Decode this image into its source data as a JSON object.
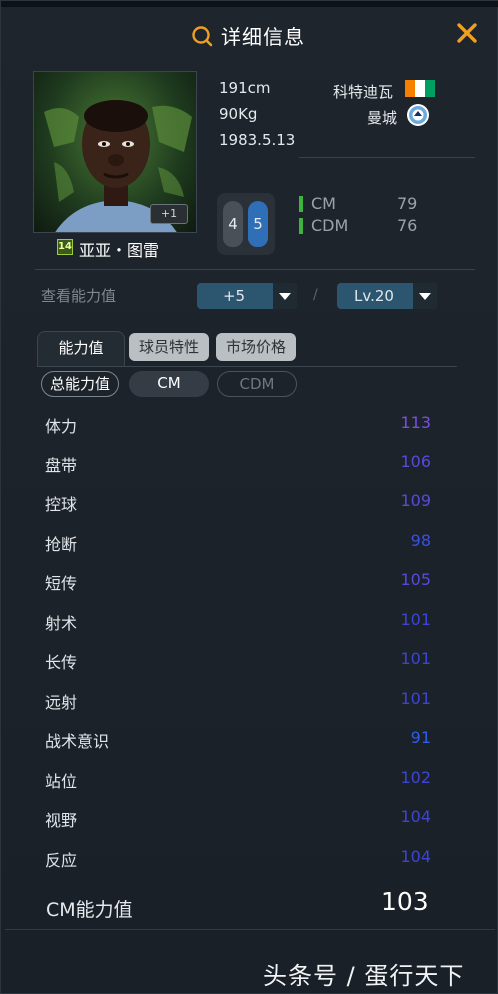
{
  "header": {
    "title": "详细信息",
    "search_icon": "search-icon",
    "close_icon": "close-icon"
  },
  "player": {
    "name": "亚亚・图雷",
    "season_badge": "14",
    "plus_badge": "+1",
    "height": "191cm",
    "weight": "90Kg",
    "birthdate": "1983.5.13",
    "nation": "科特迪瓦",
    "club": "曼城",
    "flag_colors": [
      "#f77f00",
      "#ffffff",
      "#009e60"
    ],
    "left_foot": "4",
    "right_foot": "5",
    "positions": [
      {
        "pos": "CM",
        "rating": "79"
      },
      {
        "pos": "CDM",
        "rating": "76"
      }
    ]
  },
  "controls": {
    "view_label": "查看能力值",
    "boost_select": "+5",
    "level_select": "Lv.20",
    "separator": "/"
  },
  "tabs": [
    {
      "label": "能力值",
      "active": true
    },
    {
      "label": "球员特性",
      "active": false
    },
    {
      "label": "市场价格",
      "active": false
    }
  ],
  "filters": [
    {
      "label": "总能力值"
    },
    {
      "label": "CM"
    },
    {
      "label": "CDM"
    }
  ],
  "stats": [
    {
      "name": "体力",
      "value": "113",
      "color": "#7a4fe0"
    },
    {
      "name": "盘带",
      "value": "106",
      "color": "#5a49db"
    },
    {
      "name": "控球",
      "value": "109",
      "color": "#5a49db"
    },
    {
      "name": "抢断",
      "value": "98",
      "color": "#3a4fe8"
    },
    {
      "name": "短传",
      "value": "105",
      "color": "#5a49db"
    },
    {
      "name": "射术",
      "value": "101",
      "color": "#3d45d6"
    },
    {
      "name": "长传",
      "value": "101",
      "color": "#3d45d6"
    },
    {
      "name": "远射",
      "value": "101",
      "color": "#3d45d6"
    },
    {
      "name": "战术意识",
      "value": "91",
      "color": "#2f5ce8"
    },
    {
      "name": "站位",
      "value": "102",
      "color": "#3d45d6"
    },
    {
      "name": "视野",
      "value": "104",
      "color": "#3d45d6"
    },
    {
      "name": "反应",
      "value": "104",
      "color": "#3d45d6"
    }
  ],
  "overall": {
    "label": "CM能力值",
    "value": "103"
  },
  "watermark": "头条号 / 蛋行天下"
}
